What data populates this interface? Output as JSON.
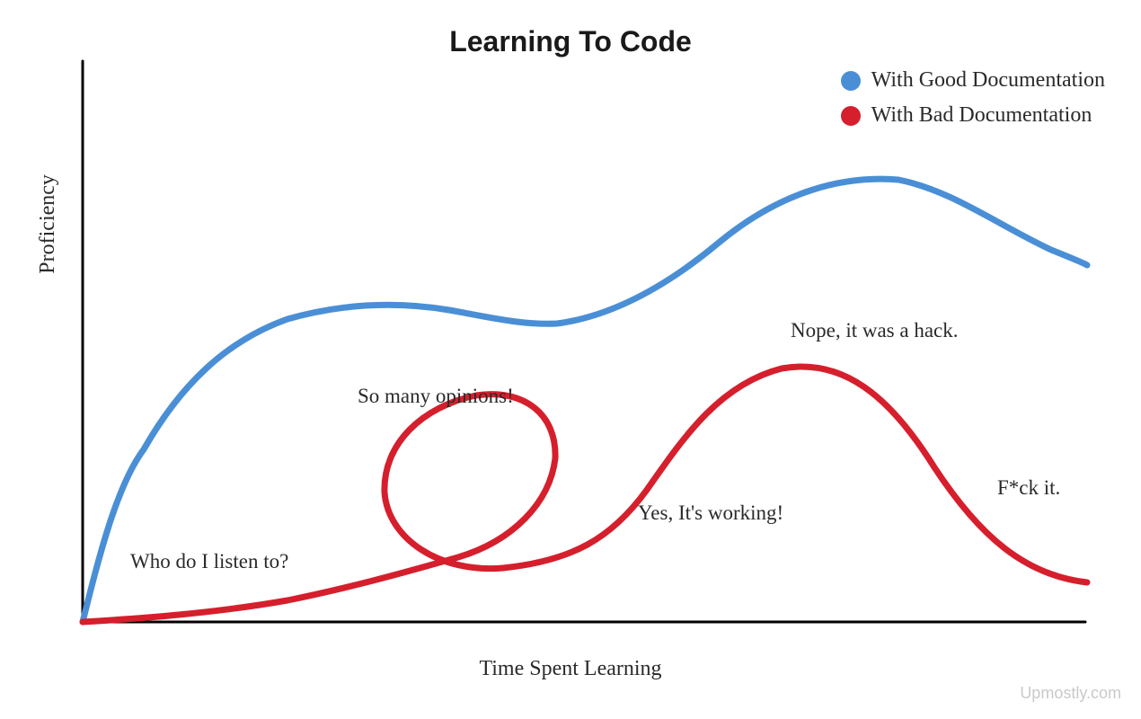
{
  "chart_data": {
    "type": "line",
    "title": "Learning To Code",
    "xlabel": "Time Spent Learning",
    "ylabel": "Proficiency",
    "xlim": [
      0,
      100
    ],
    "ylim": [
      0,
      100
    ],
    "series": [
      {
        "name": "With Good Documentation",
        "color": "#4a8fd6",
        "points": [
          {
            "x": 0,
            "y": 0
          },
          {
            "x": 6,
            "y": 28
          },
          {
            "x": 14,
            "y": 46
          },
          {
            "x": 24,
            "y": 55
          },
          {
            "x": 34,
            "y": 56
          },
          {
            "x": 44,
            "y": 52
          },
          {
            "x": 54,
            "y": 52
          },
          {
            "x": 64,
            "y": 62
          },
          {
            "x": 74,
            "y": 78
          },
          {
            "x": 84,
            "y": 80
          },
          {
            "x": 94,
            "y": 71
          },
          {
            "x": 100,
            "y": 67
          }
        ]
      },
      {
        "name": "With Bad Documentation",
        "color": "#d61f2c",
        "points": [
          {
            "x": 0,
            "y": 0
          },
          {
            "x": 12,
            "y": 2
          },
          {
            "x": 24,
            "y": 5
          },
          {
            "x": 33,
            "y": 9
          },
          {
            "x": 44,
            "y": 14
          },
          {
            "x": 48,
            "y": 30
          },
          {
            "x": 44,
            "y": 39
          },
          {
            "x": 35,
            "y": 38
          },
          {
            "x": 30,
            "y": 28
          },
          {
            "x": 33,
            "y": 16
          },
          {
            "x": 40,
            "y": 10
          },
          {
            "x": 50,
            "y": 12
          },
          {
            "x": 57,
            "y": 20
          },
          {
            "x": 63,
            "y": 36
          },
          {
            "x": 71,
            "y": 46
          },
          {
            "x": 78,
            "y": 44
          },
          {
            "x": 85,
            "y": 30
          },
          {
            "x": 92,
            "y": 14
          },
          {
            "x": 100,
            "y": 10
          }
        ]
      }
    ],
    "annotations": [
      {
        "text": "Who do I listen to?",
        "x": 12,
        "y": 9
      },
      {
        "text": "So many opinions!",
        "x": 34,
        "y": 42
      },
      {
        "text": "Yes, It's working!",
        "x": 58,
        "y": 22
      },
      {
        "text": "Nope, it was a hack.",
        "x": 72,
        "y": 52
      },
      {
        "text": "F*ck it.",
        "x": 90,
        "y": 28
      }
    ],
    "attribution": "Upmostly.com",
    "legend_position": "top-right"
  }
}
